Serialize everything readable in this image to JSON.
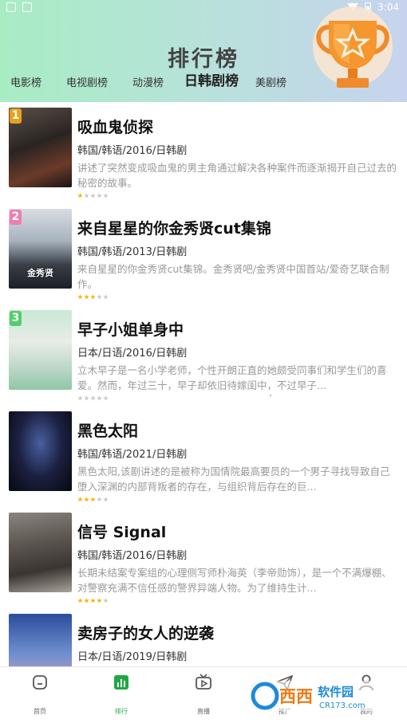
{
  "status_bar": {
    "time": "3:04"
  },
  "header": {
    "title": "排行榜"
  },
  "tabs": [
    {
      "label": "电影榜",
      "active": false
    },
    {
      "label": "电视剧榜",
      "active": false
    },
    {
      "label": "动漫榜",
      "active": false
    },
    {
      "label": "日韩剧榜",
      "active": true
    },
    {
      "label": "美剧榜",
      "active": false
    }
  ],
  "items": [
    {
      "rank": "1",
      "rank_color": "#e8a21a",
      "poster_caption": "",
      "title": "吸血鬼侦探",
      "meta": "韩国/韩语/2016/日韩剧",
      "desc": "讲述了突然变成吸血鬼的男主角通过解决各种案件而逐渐揭开自己过去的秘密的故事。",
      "stars": 1
    },
    {
      "rank": "2",
      "rank_color": "#f07cb2",
      "poster_caption": "金秀贤",
      "title": "来自星星的你金秀贤cut集锦",
      "meta": "韩国/韩语/2013/日韩剧",
      "desc": "来自星星的你金秀贤cut集锦。金秀贤吧/金秀贤中国首站/爱奇艺联合制作。",
      "stars": 3
    },
    {
      "rank": "3",
      "rank_color": "#4fcf6a",
      "poster_caption": "",
      "title": "早子小姐单身中",
      "meta": "日本/日语/2016/日韩剧",
      "desc": "立木早子是一名小学老师，个性开朗正直的她颇受同事们和学生们的喜爱。然而，年过三十，早子却依旧待嫁闺中，不过早子...",
      "stars": 0
    },
    {
      "rank": "",
      "rank_color": "",
      "poster_caption": "",
      "title": "黑色太阳",
      "meta": "韩国/韩语/2021/日韩剧",
      "desc": "黑色太阳,该剧讲述的是被称为国情院最高要员的一个男子寻找导致自己堕入深渊的内部背叛者的存在，与组织背后存在的巨...",
      "stars": 3
    },
    {
      "rank": "",
      "rank_color": "",
      "poster_caption": "",
      "title": "信号 Signal",
      "meta": "韩国/韩语/2016/日韩剧",
      "desc": "长期未结案专案组的心理侧写师朴海英（李帝勋饰），是一个不满爆棚、对警察充满不信任感的警界异端人物。为了维持生计...",
      "stars": 4
    },
    {
      "rank": "",
      "rank_color": "",
      "poster_caption": "",
      "title": "卖房子的女人的逆袭",
      "meta": "日本/日语/2019/日韩剧",
      "desc": "",
      "stars": 0
    }
  ],
  "bottom_nav": [
    {
      "label": "首页",
      "icon": "home-icon",
      "active": false
    },
    {
      "label": "排行",
      "icon": "ranking-icon",
      "active": true
    },
    {
      "label": "直播",
      "icon": "tv-icon",
      "active": false
    },
    {
      "label": "推广",
      "icon": "send-icon",
      "active": false
    },
    {
      "label": "我的",
      "icon": "user-icon",
      "active": false
    }
  ],
  "watermark": {
    "brand": "西西",
    "text": "软件园",
    "url": "CR173.com"
  },
  "colors": {
    "accent": "#1fa843",
    "star_on": "#f5b400",
    "star_off": "#c8c8c8"
  }
}
